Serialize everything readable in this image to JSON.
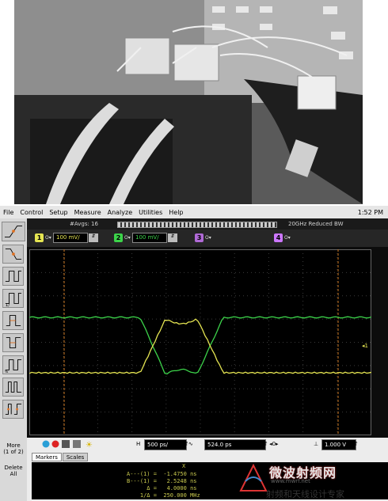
{
  "menu": {
    "items": [
      "File",
      "Control",
      "Setup",
      "Measure",
      "Analyze",
      "Utilities",
      "Help"
    ],
    "clock": "1:52 PM"
  },
  "toolbar": {
    "averages": "#Avgs: 16",
    "bandwidth": "20GHz Reduced BW"
  },
  "channels": [
    {
      "number": "1",
      "scale": "100 mV/",
      "color": "#e5e552"
    },
    {
      "number": "2",
      "scale": "100 mV/",
      "color": "#3cd34a"
    },
    {
      "number": "3",
      "color": "#b06ad6"
    },
    {
      "number": "4",
      "color": "#cc77ff"
    }
  ],
  "left_panel": {
    "more_label": "More\n(1 of 2)",
    "delete_label": "Delete\nAll"
  },
  "timebase": {
    "scale": "500 ps/",
    "delay": "524.0 ps",
    "trigger_level": "1.000 V"
  },
  "tabs": [
    "Markers",
    "Scales"
  ],
  "markers": {
    "header": "X",
    "rows": [
      "A---(1) =  -1.4750 ns",
      "B---(1) =   2.5248 ns",
      "      Δ =   4.0000 ns",
      "    1/Δ =  250.000 MHz"
    ]
  },
  "waveform": {
    "type": "line",
    "xlabel": "",
    "ylabel": "",
    "ch1_label": "1",
    "colors": {
      "ch1": "#e5e552",
      "ch2": "#3cd34a",
      "markers": "#cc7722"
    }
  },
  "watermark": {
    "title": "微波射频网",
    "url": "www.mwrf.net",
    "subtitle": "射频和天线设计专家"
  }
}
